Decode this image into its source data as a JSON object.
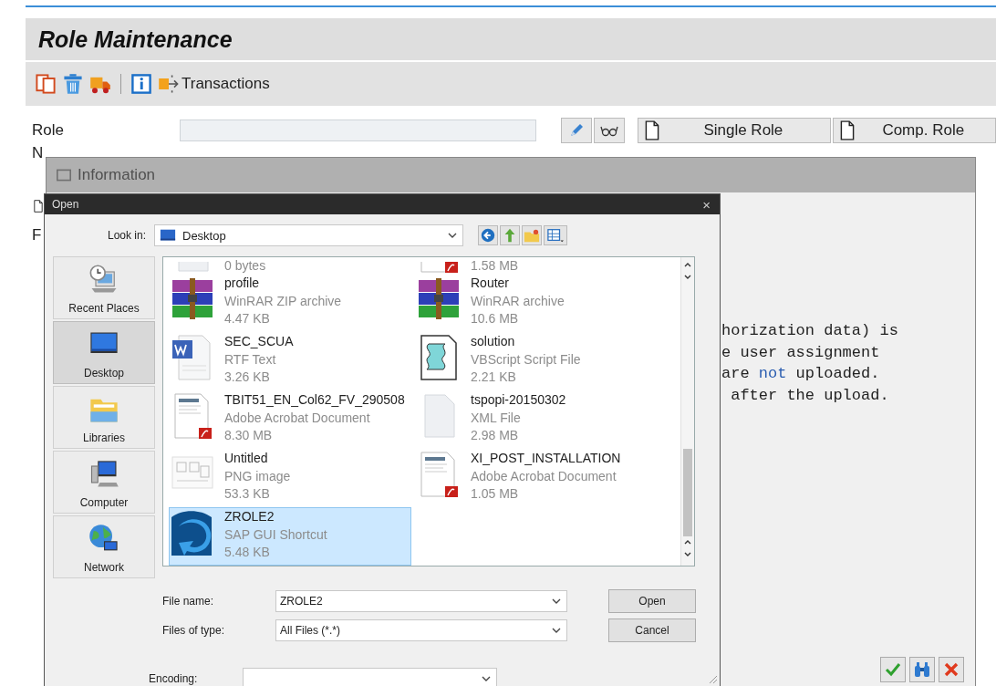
{
  "sap": {
    "title": "Role Maintenance",
    "toolbar": [
      {
        "kind": "copy"
      },
      {
        "kind": "trash"
      },
      {
        "kind": "truck"
      },
      {
        "kind": "separator"
      },
      {
        "kind": "info"
      },
      {
        "kind": "transactions",
        "label": "Transactions"
      }
    ],
    "role_label": "Role",
    "role_tools": [
      {
        "kind": "pencil"
      },
      {
        "kind": "glasses"
      }
    ],
    "role_types": [
      {
        "label": "Single Role"
      },
      {
        "label": "Comp. Role"
      }
    ],
    "cut_labels": [
      "N",
      "F"
    ]
  },
  "info_dialog": {
    "title": "Information",
    "message": [
      [
        {
          "text": "horization data) is",
          "highlighted": false
        }
      ],
      [
        {
          "text": "e user assignment",
          "highlighted": false
        }
      ],
      [
        {
          "text": "are ",
          "highlighted": false
        },
        {
          "text": "not",
          "highlighted": true
        },
        {
          "text": " uploaded.",
          "highlighted": false
        }
      ],
      [
        {
          "text": " after the upload.",
          "highlighted": false
        }
      ]
    ],
    "buttons": [
      {
        "kind": "check"
      },
      {
        "kind": "binoculars"
      },
      {
        "kind": "cancel"
      }
    ]
  },
  "open_dialog": {
    "title": "Open",
    "close": "×",
    "look_in_label": "Look in:",
    "look_in": "Desktop",
    "tools": [
      {
        "kind": "back"
      },
      {
        "kind": "up"
      },
      {
        "kind": "new-folder"
      },
      {
        "kind": "views"
      }
    ],
    "places": [
      {
        "label": "Recent Places",
        "kind": "recent",
        "selected": false
      },
      {
        "label": "Desktop",
        "kind": "desktop",
        "selected": true
      },
      {
        "label": "Libraries",
        "kind": "libraries",
        "selected": false
      },
      {
        "label": "Computer",
        "kind": "computer",
        "selected": false
      },
      {
        "label": "Network",
        "kind": "network",
        "selected": false
      }
    ],
    "files": [
      {
        "size": "0 bytes",
        "kind": "blank",
        "selected": false
      },
      {
        "size": "1.58 MB",
        "kind": "pdf",
        "selected": false
      },
      {
        "name": "profile",
        "type": "WinRAR ZIP archive",
        "size": "4.47 KB",
        "kind": "archive",
        "selected": false
      },
      {
        "name": "Router",
        "type": "WinRAR archive",
        "size": "10.6 MB",
        "kind": "archive",
        "selected": false
      },
      {
        "name": "SEC_SCUA",
        "type": "RTF Text",
        "size": "3.26 KB",
        "kind": "word",
        "selected": false
      },
      {
        "name": "solution",
        "type": "VBScript Script File",
        "size": "2.21 KB",
        "kind": "script",
        "selected": false
      },
      {
        "name": "TBIT51_EN_Col62_FV_290508",
        "type": "Adobe Acrobat Document",
        "size": "8.30 MB",
        "kind": "pdf",
        "selected": false
      },
      {
        "name": "tspopi-20150302",
        "type": "XML File",
        "size": "2.98 MB",
        "kind": "blank",
        "selected": false
      },
      {
        "name": "Untitled",
        "type": "PNG image",
        "size": "53.3 KB",
        "kind": "image",
        "selected": false
      },
      {
        "name": "XI_POST_INSTALLATION",
        "type": "Adobe Acrobat Document",
        "size": "1.05 MB",
        "kind": "pdf",
        "selected": false
      },
      {
        "name": "ZROLE2",
        "type": "SAP GUI Shortcut",
        "size": "5.48 KB",
        "kind": "shortcut",
        "selected": true
      }
    ],
    "file_name_label": "File name:",
    "file_name": "ZROLE2",
    "file_type_label": "Files of type:",
    "file_type": "All Files (*.*)",
    "buttons": [
      "Open",
      "Cancel"
    ],
    "encoding_label": "Encoding:"
  }
}
